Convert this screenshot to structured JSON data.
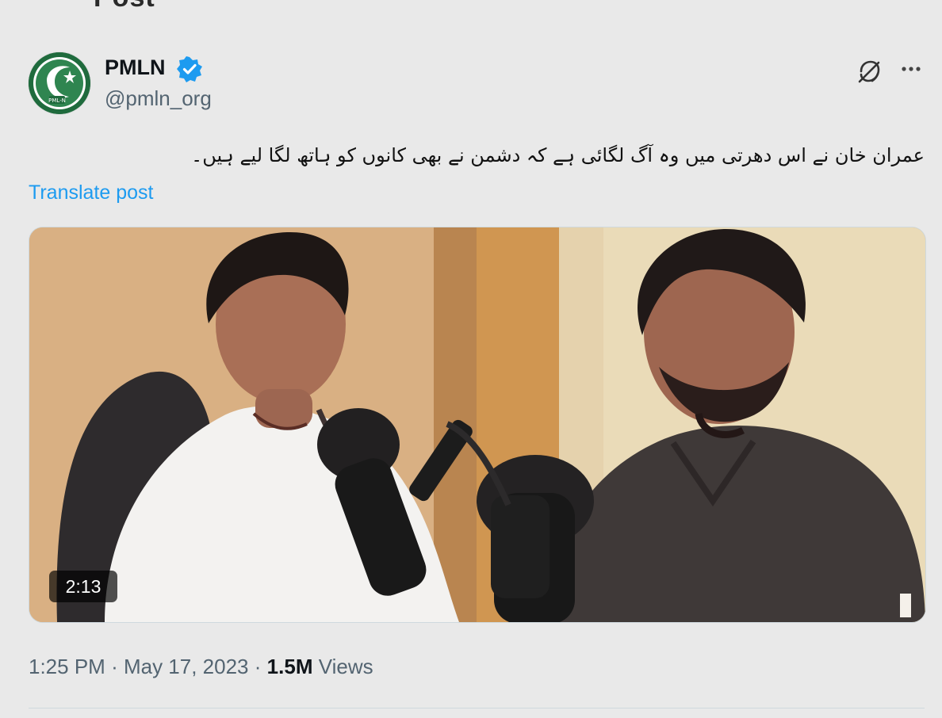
{
  "header": {
    "title": "Post"
  },
  "post": {
    "author": {
      "display_name": "PMLN",
      "handle": "@pmln_org",
      "verified": true,
      "avatar_icon": "pmln-logo",
      "avatar_text": "PML-N"
    },
    "text": "عمران خان نے اس دھرتی میں وہ آگ لگائی ہے کہ دشمن نے بھی کانوں کو ہاتھ لگا لیے ہیں۔",
    "translate_label": "Translate post",
    "media": {
      "type": "video",
      "duration": "2:13"
    },
    "timestamp": "1:25 PM",
    "date": "May 17, 2023",
    "separator": "·",
    "views_count": "1.5M",
    "views_label": "Views"
  },
  "icons": {
    "verified": "verified-badge-icon",
    "grok": "grok-icon",
    "more": "more-icon"
  },
  "colors": {
    "accent": "#1d9bf0",
    "muted": "#536471",
    "text": "#0f1419",
    "background": "#e9e9e9"
  }
}
